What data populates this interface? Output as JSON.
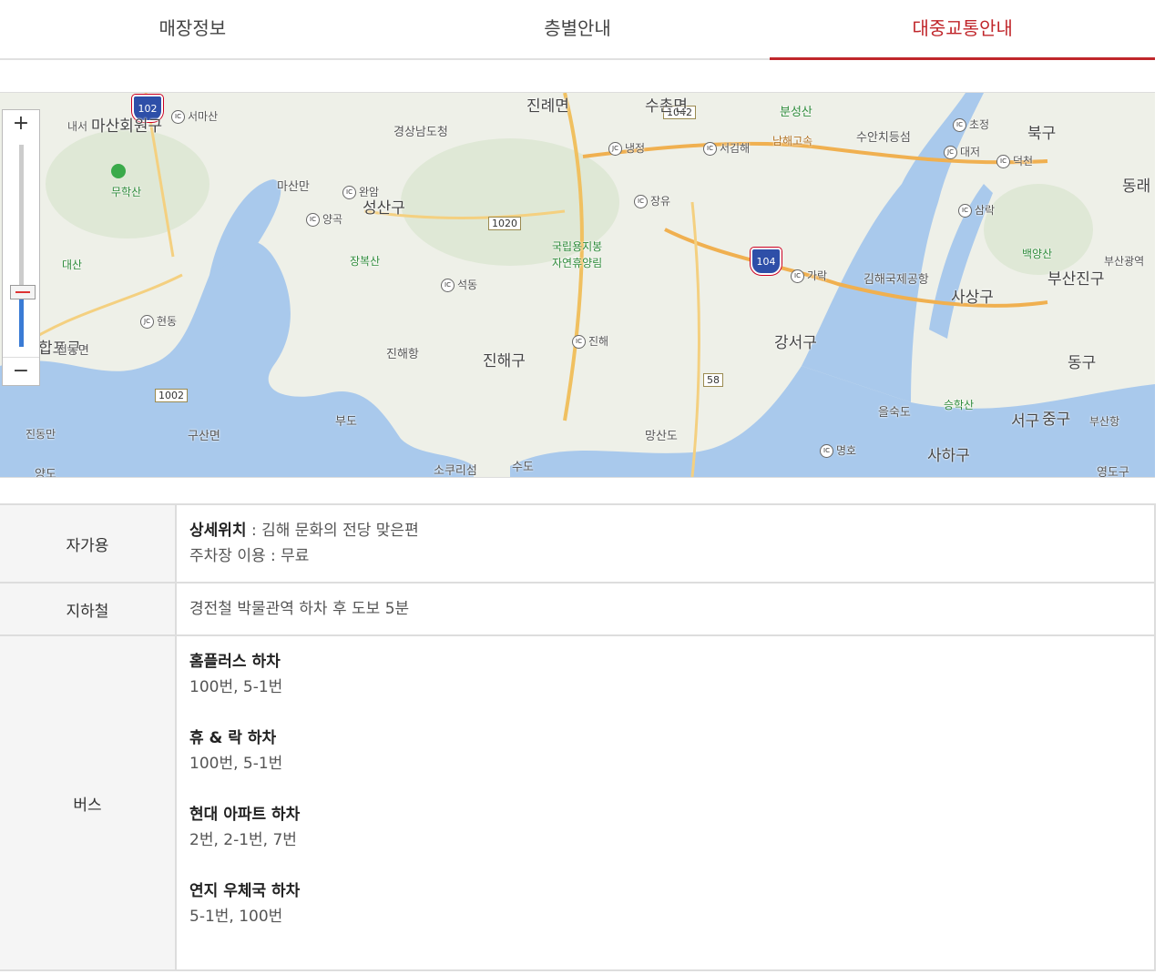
{
  "tabs": [
    {
      "label": "매장정보",
      "active": false
    },
    {
      "label": "층별안내",
      "active": false
    },
    {
      "label": "대중교통안내",
      "active": true
    }
  ],
  "map": {
    "zoom_in": "+",
    "zoom_out": "−",
    "labels": {
      "masanhoewon": "마산회원구",
      "naeseo": "내서",
      "seomasan": "서마산",
      "gyeongnam": "경상남도청",
      "jillyeo": "진례면",
      "suchon": "수촌면",
      "bunseong": "분성산",
      "suanchi": "수안치등섬",
      "chojeong": "초정",
      "bukgu": "북구",
      "dongrae": "동래",
      "muhak": "무학산",
      "masanman": "마산만",
      "wanam": "완암",
      "seongsan": "성산구",
      "yanggok": "양곡",
      "nengjeong": "냉정",
      "seogimhae": "서김해",
      "namhae": "남해고속",
      "daejeo": "대저",
      "deokcheon": "덕천",
      "jangyu": "장유",
      "daesan": "대산",
      "jangbok": "장복산",
      "yongjibong": "국립용지봉",
      "yongjibong2": "자연휴양림",
      "samrak": "삼락",
      "baekyang": "백양산",
      "busangwang": "부산광역",
      "seokdong": "석동",
      "garak": "가락",
      "gimhaeair": "김해국제공항",
      "sasang": "사상구",
      "busanjin": "부산진구",
      "hyeondong": "현동",
      "jinhae_port": "진해항",
      "jinhae": "진해",
      "jinhaegu": "진해구",
      "gangseo": "강서구",
      "dongu": "동구",
      "jinjeon": "진동면",
      "happo": "합포구",
      "jindong": "진동만",
      "budo": "부도",
      "gusan": "구산면",
      "mangsan": "망산도",
      "eulsuk": "을숙도",
      "seunghak": "승학산",
      "seogu": "서구",
      "junggu": "중구",
      "busanport": "부산항",
      "myeongho": "명호",
      "saha": "사하구",
      "yangdo": "양도",
      "sokuri": "소쿠리섬",
      "sudo": "수도",
      "yeongdo": "영도구",
      "r1042": "1042",
      "r1020": "1020",
      "r1002": "1002",
      "r58": "58",
      "s102": "102",
      "s104": "104",
      "ic": "IC",
      "jc": "JC"
    }
  },
  "table": {
    "rows": [
      {
        "head": "자가용",
        "line1_strong": "상세위치",
        "line1_rest": " : 김해 문화의 전당 맞은편",
        "line2": "주차장 이용 : 무료"
      },
      {
        "head": "지하철",
        "text": "경전철 박물관역 하차 후 도보 5분"
      },
      {
        "head": "버스",
        "stops": [
          {
            "name": "홈플러스 하차",
            "routes": "100번, 5-1번"
          },
          {
            "name": "휴 & 락 하차",
            "routes": "100번, 5-1번"
          },
          {
            "name": "현대 아파트 하차",
            "routes": "2번, 2-1번, 7번"
          },
          {
            "name": "연지 우체국 하차",
            "routes": "5-1번, 100번"
          }
        ]
      }
    ]
  }
}
